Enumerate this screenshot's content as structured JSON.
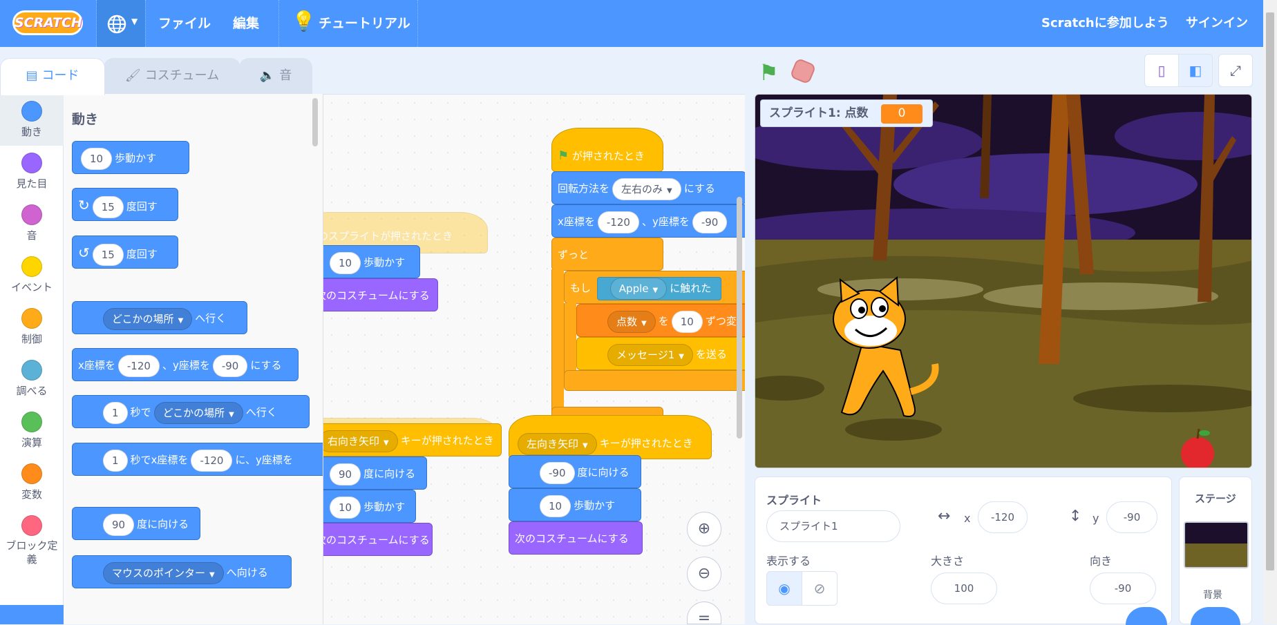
{
  "menu": {
    "logo": "SCRATCH",
    "file": "ファイル",
    "edit": "編集",
    "tutorials": "チュートリアル",
    "join": "Scratchに参加しよう",
    "signin": "サインイン"
  },
  "tabs": {
    "code": "コード",
    "costumes": "コスチューム",
    "sounds": "音"
  },
  "categories": [
    {
      "label": "動き",
      "color": "#4c97ff"
    },
    {
      "label": "見た目",
      "color": "#9966ff"
    },
    {
      "label": "音",
      "color": "#cf63cf"
    },
    {
      "label": "イベント",
      "color": "#ffd500"
    },
    {
      "label": "制御",
      "color": "#ffab19"
    },
    {
      "label": "調べる",
      "color": "#5cb1d6"
    },
    {
      "label": "演算",
      "color": "#59c059"
    },
    {
      "label": "変数",
      "color": "#ff8c1a"
    },
    {
      "label": "ブロック定義",
      "color": "#ff6680"
    }
  ],
  "palette": {
    "heading": "動き",
    "move_steps": "10",
    "move_label": "歩動かす",
    "turn_right_deg": "15",
    "turn_right_label": "度回す",
    "turn_left_deg": "15",
    "turn_left_label": "度回す",
    "goto_target": "どこかの場所",
    "goto_label": "へ行く",
    "gotoxy_x_label": "x座標を",
    "gotoxy_x": "-120",
    "gotoxy_y_label": "、y座標を",
    "gotoxy_y": "-90",
    "gotoxy_end": "にする",
    "glide_secs": "1",
    "glide_label": "秒で",
    "glide_target": "どこかの場所",
    "glide_end": "へ行く",
    "glidexy_secs": "1",
    "glidexy_label": "秒でx座標を",
    "glidexy_x": "-120",
    "glidexy_mid": "に、y座標を",
    "point_dir": "90",
    "point_label": "度に向ける",
    "point_towards_target": "マウスのポインター",
    "point_towards_label": "へ向ける"
  },
  "scripts": {
    "s1_hat": "このスプライトが押されたとき",
    "s1_steps": "10",
    "s1_move": "歩動かす",
    "s1_costume": "次のコスチュームにする",
    "s2_key": "右向き矢印",
    "s2_hat": "キーが押されたとき",
    "s2_dir": "90",
    "s2_point": "度に向ける",
    "s2_steps": "10",
    "s2_move": "歩動かす",
    "s2_costume": "次のコスチュームにする",
    "s3_hat": "が押されたとき",
    "s3_rot_label": "回転方法を",
    "s3_rot_value": "左右のみ",
    "s3_rot_end": "にする",
    "s3_x_label": "x座標を",
    "s3_x": "-120",
    "s3_y_label": "、y座標を",
    "s3_y": "-90",
    "s3_forever": "ずっと",
    "s3_if": "もし",
    "s3_touch_target": "Apple",
    "s3_touch_label": "に触れた",
    "s3_var": "点数",
    "s3_var_by": "を",
    "s3_var_val": "10",
    "s3_var_end": "ずつ変",
    "s3_msg": "メッセージ1",
    "s3_send": "を送る",
    "s4_key": "左向き矢印",
    "s4_hat": "キーが押されたとき",
    "s4_dir": "-90",
    "s4_point": "度に向ける",
    "s4_steps": "10",
    "s4_move": "歩動かす",
    "s4_costume": "次のコスチュームにする"
  },
  "stage": {
    "monitor_label": "スプライト1: 点数",
    "monitor_value": "0"
  },
  "sprite_info": {
    "sprite_label": "スプライト",
    "sprite_name": "スプライト1",
    "x_label": "x",
    "x_value": "-120",
    "y_label": "y",
    "y_value": "-90",
    "show_label": "表示する",
    "size_label": "大きさ",
    "size_value": "100",
    "direction_label": "向き",
    "direction_value": "-90"
  },
  "stage_pane": {
    "title": "ステージ",
    "backdrop_label": "背景"
  }
}
